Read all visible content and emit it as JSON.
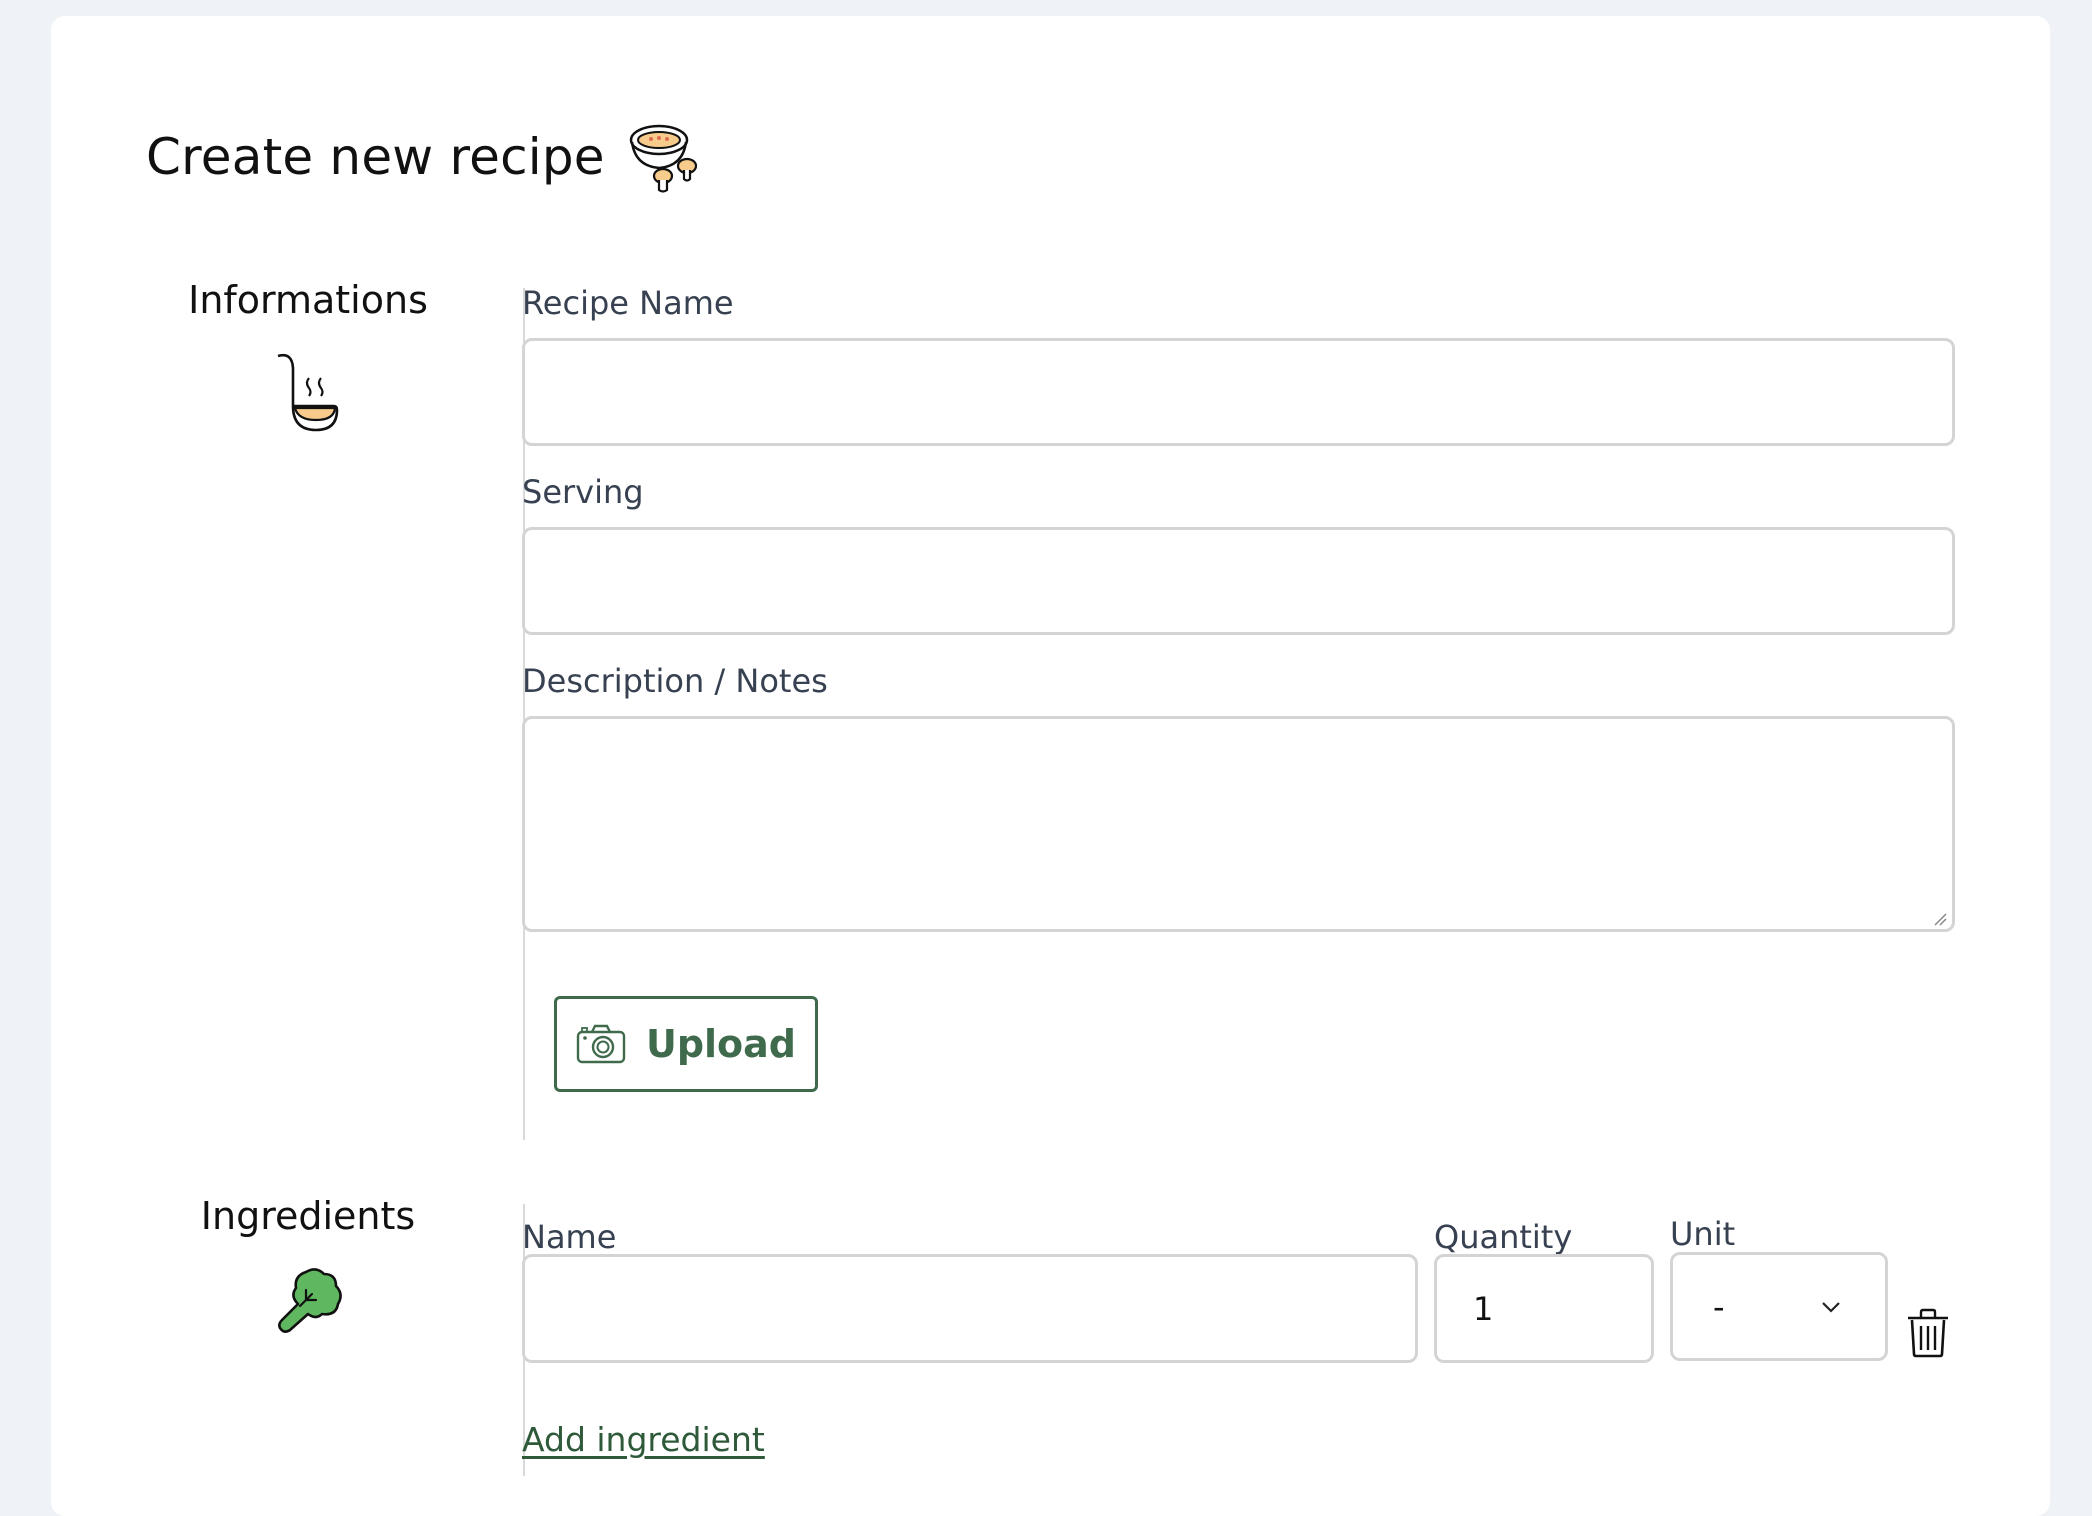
{
  "page": {
    "title": "Create new recipe",
    "title_icon": "soup-bowl-icon"
  },
  "informations": {
    "heading": "Informations",
    "icon": "ladle-icon",
    "recipe_name_label": "Recipe Name",
    "recipe_name_value": "",
    "serving_label": "Serving",
    "serving_value": "",
    "description_label": "Description / Notes",
    "description_value": "",
    "upload_label": "Upload",
    "upload_icon": "camera-icon"
  },
  "ingredients": {
    "heading": "Ingredients",
    "icon": "broccoli-icon",
    "name_label": "Name",
    "quantity_label": "Quantity",
    "unit_label": "Unit",
    "rows": [
      {
        "name": "",
        "quantity": "1",
        "unit": "-"
      }
    ],
    "delete_icon": "trash-icon",
    "add_label": "Add ingredient"
  },
  "colors": {
    "background": "#eff2f6",
    "card": "#ffffff",
    "accent_green": "#3f6b4c",
    "link_green": "#2f5a3a",
    "label_text": "#374151",
    "input_border": "#d4d4d4",
    "icon_fill_orange": "#f7cb8c",
    "icon_fill_green": "#5fb85f"
  }
}
